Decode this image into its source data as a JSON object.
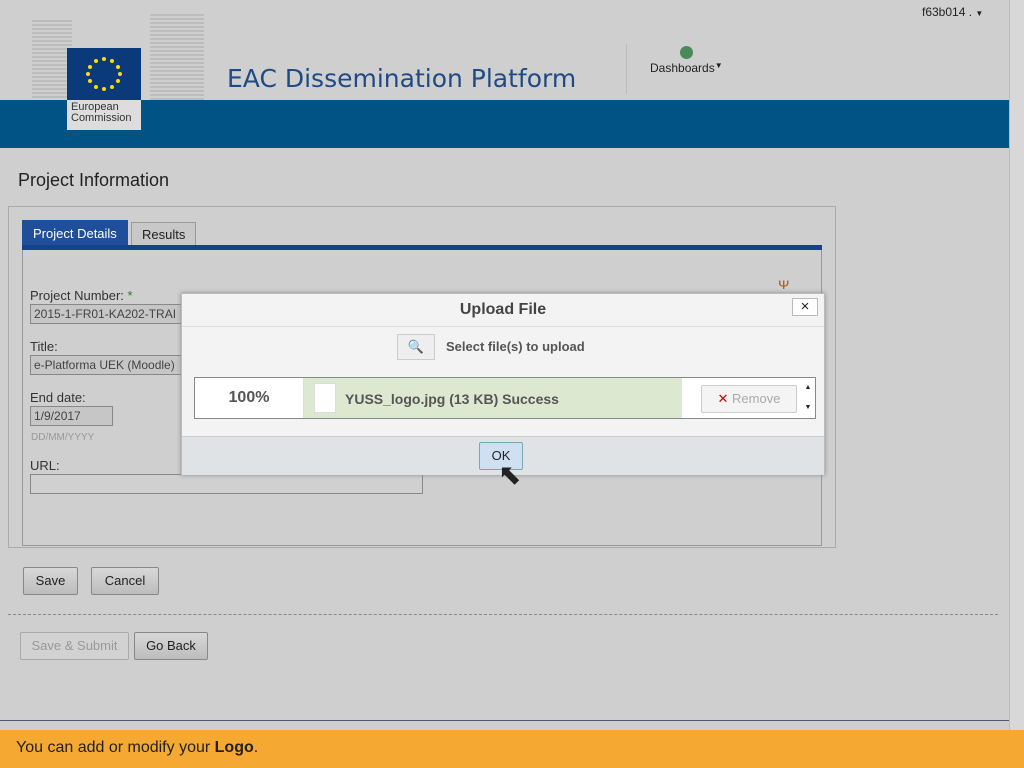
{
  "header": {
    "title": "EAC Dissemination Platform",
    "logo_text": "European Commission",
    "dashboards": "Dashboards",
    "user": "f63b014 ."
  },
  "page": {
    "title": "Project Information",
    "tabs": [
      {
        "label": "Project Details",
        "active": true
      },
      {
        "label": "Results",
        "active": false
      }
    ],
    "fields": {
      "project_number_label": "Project Number:",
      "required_mark": "*",
      "project_number": "2015-1-FR01-KA202-TRAI",
      "title_label": "Title:",
      "title": "e-Platforma UEK (Moodle)",
      "end_date_label": "End date:",
      "end_date": "1/9/2017",
      "date_hint": "DD/MM/YYYY",
      "url_label": "URL:",
      "url": ""
    },
    "buttons": {
      "save": "Save",
      "cancel": "Cancel",
      "save_submit": "Save & Submit",
      "go_back": "Go Back"
    }
  },
  "dialog": {
    "title": "Upload File",
    "close": "×",
    "select": "Select file(s) to upload",
    "progress": "100%",
    "file": "YUSS_logo.jpg (13 KB) Success",
    "remove": "Remove",
    "ok": "OK"
  },
  "banner": {
    "text": "You can add or modify your ",
    "bold": "Logo",
    "end": "."
  },
  "colors": {
    "band": "#005384",
    "banner": "#f5a832",
    "tab_active": "#17408f"
  }
}
